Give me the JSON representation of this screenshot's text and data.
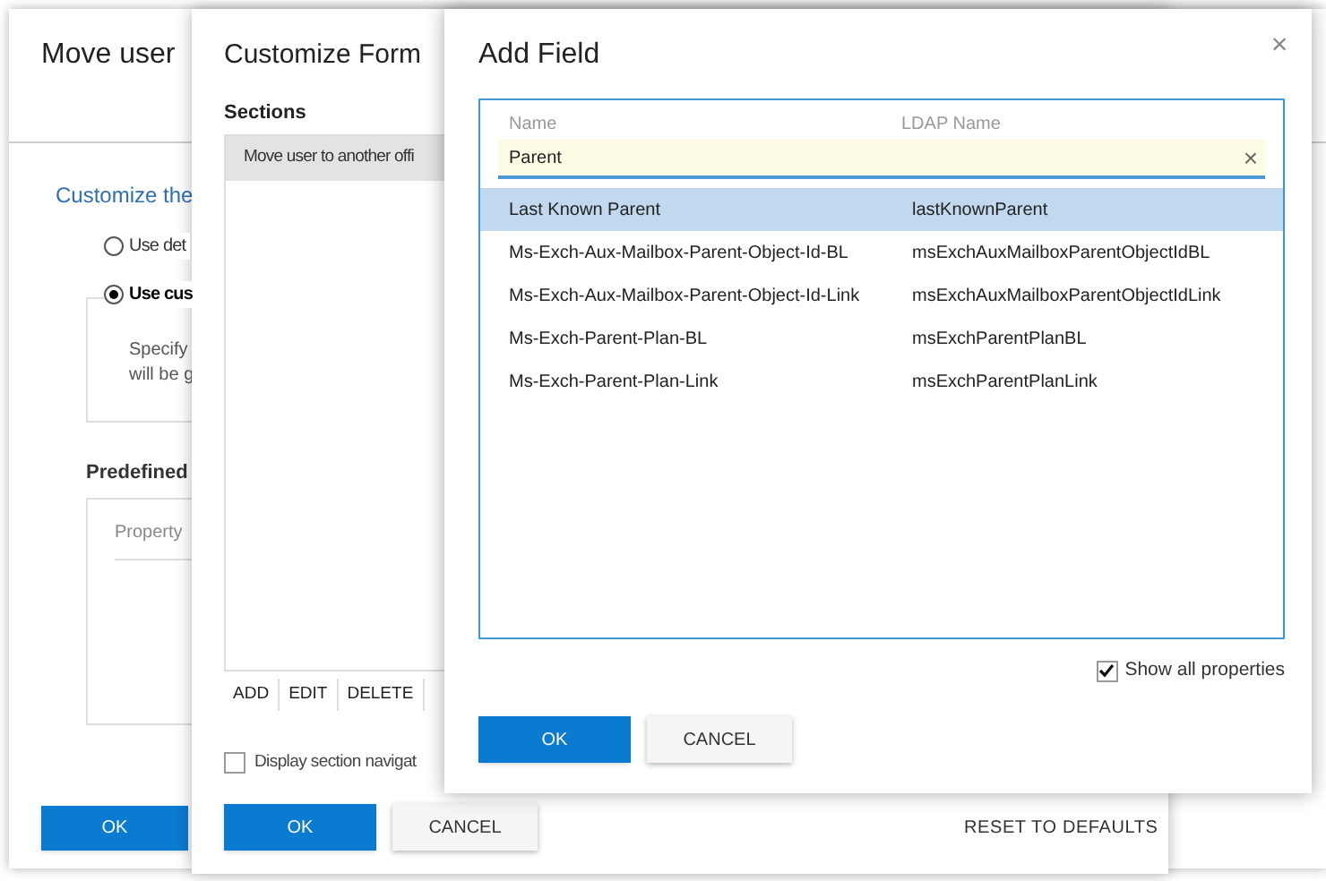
{
  "move_user_dialog": {
    "title": "Move user",
    "section_heading": "Customize the",
    "radios": [
      {
        "label": "Use det",
        "selected": false
      },
      {
        "label": "Use cus",
        "selected": true
      }
    ],
    "description_lines": [
      "Specify",
      "will be g"
    ],
    "predefined_label": "Predefined",
    "property_header": "Property",
    "ok_button": "OK"
  },
  "customize_form_dialog": {
    "title": "Customize Form",
    "sections_label": "Sections",
    "sections": [
      {
        "label": "Move user to another offi",
        "selected": true
      }
    ],
    "list_buttons": [
      "ADD",
      "EDIT",
      "DELETE"
    ],
    "display_navigation": {
      "label": "Display section navigat",
      "checked": false
    },
    "ok_button": "OK",
    "cancel_button": "CANCEL",
    "reset_button": "RESET TO DEFAULTS"
  },
  "add_field_dialog": {
    "title": "Add Field",
    "close": "×",
    "columns": [
      "Name",
      "LDAP Name"
    ],
    "filter": {
      "value": "Parent",
      "clear": "×"
    },
    "rows": [
      {
        "name": "Last Known Parent",
        "ldap_name": "lastKnownParent",
        "selected": true
      },
      {
        "name": "Ms-Exch-Aux-Mailbox-Parent-Object-Id-BL",
        "ldap_name": "msExchAuxMailboxParentObjectIdBL",
        "selected": false
      },
      {
        "name": "Ms-Exch-Aux-Mailbox-Parent-Object-Id-Link",
        "ldap_name": "msExchAuxMailboxParentObjectIdLink",
        "selected": false
      },
      {
        "name": "Ms-Exch-Parent-Plan-BL",
        "ldap_name": "msExchParentPlanBL",
        "selected": false
      },
      {
        "name": "Ms-Exch-Parent-Plan-Link",
        "ldap_name": "msExchParentPlanLink",
        "selected": false
      }
    ],
    "show_all": {
      "label": "Show all properties",
      "checked": true
    },
    "ok_button": "OK",
    "cancel_button": "CANCEL"
  }
}
